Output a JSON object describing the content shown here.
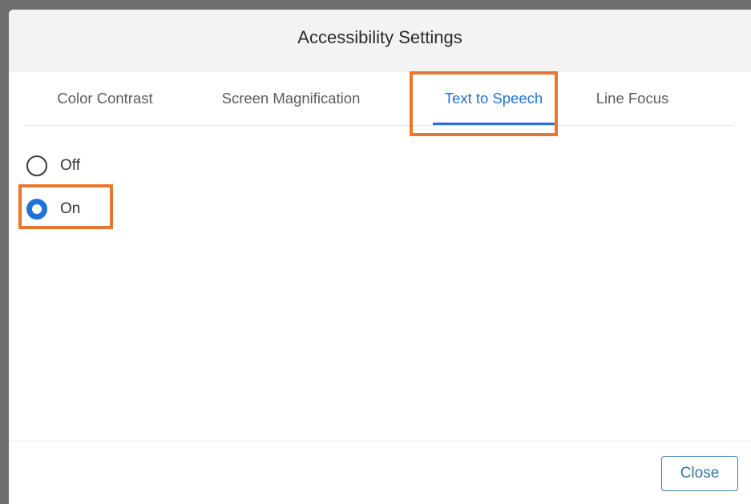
{
  "dialog": {
    "title": "Accessibility Settings"
  },
  "tabs": [
    {
      "label": "Color Contrast",
      "active": false
    },
    {
      "label": "Screen Magnification",
      "active": false
    },
    {
      "label": "Text to Speech",
      "active": true
    },
    {
      "label": "Line Focus",
      "active": false
    }
  ],
  "text_to_speech": {
    "options": [
      {
        "label": "Off",
        "checked": false
      },
      {
        "label": "On",
        "checked": true
      }
    ]
  },
  "footer": {
    "close_label": "Close"
  },
  "colors": {
    "accent": "#1f73d8",
    "highlight": "#e8762c",
    "header_bg": "#f2f3f3",
    "backdrop": "#6f6f6f"
  }
}
